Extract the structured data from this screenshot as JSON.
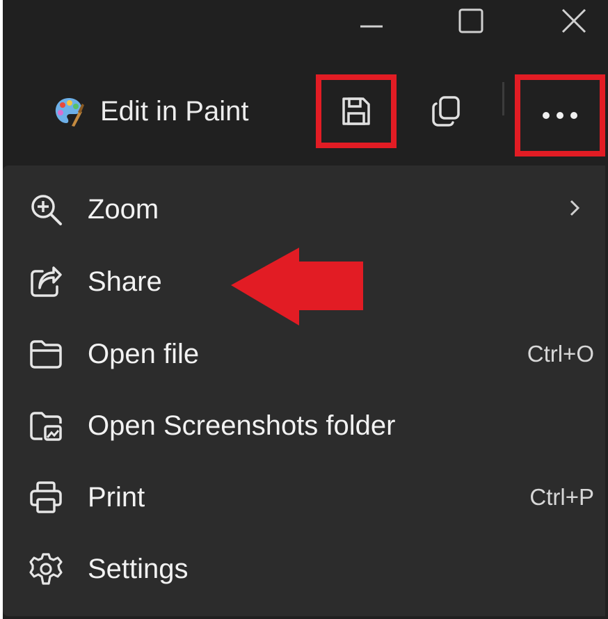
{
  "window": {
    "caption_buttons": [
      {
        "name": "minimize-icon"
      },
      {
        "name": "maximize-icon"
      },
      {
        "name": "close-icon"
      }
    ]
  },
  "toolbar": {
    "edit_in_paint_label": "Edit in Paint",
    "icons": [
      "paint-palette-icon",
      "save-icon",
      "copy-icon",
      "more-options-icon"
    ],
    "highlight_color": "#e21c24"
  },
  "menu": {
    "items": [
      {
        "label": "Zoom",
        "icon": "zoom-in-icon",
        "shortcut": "",
        "has_submenu": true
      },
      {
        "label": "Share",
        "icon": "share-icon",
        "shortcut": ""
      },
      {
        "label": "Open file",
        "icon": "folder-icon",
        "shortcut": "Ctrl+O"
      },
      {
        "label": "Open Screenshots folder",
        "icon": "screenshots-folder-icon",
        "shortcut": ""
      },
      {
        "label": "Print",
        "icon": "printer-icon",
        "shortcut": "Ctrl+P"
      },
      {
        "label": "Settings",
        "icon": "gear-icon",
        "shortcut": ""
      }
    ]
  },
  "annotation": {
    "arrow_color": "#e21c24",
    "points_to": "Share"
  }
}
